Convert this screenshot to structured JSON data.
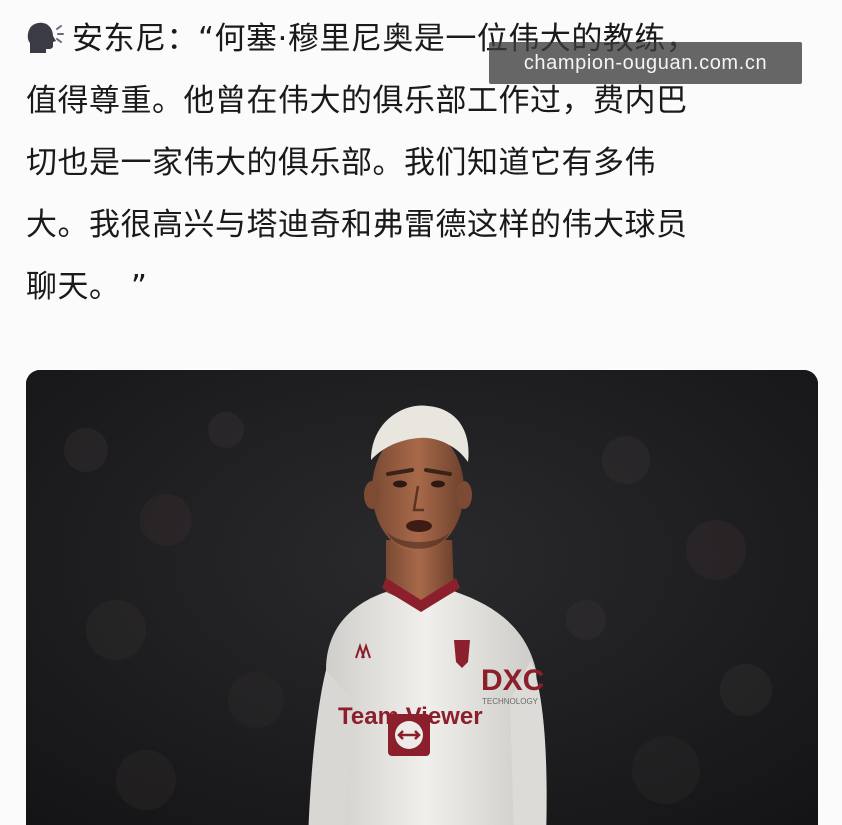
{
  "post": {
    "lines": [
      "安东尼：“何塞·穆里尼奥是一位伟大的教练，",
      "值得尊重。他曾在伟大的俱乐部工作过，费内巴",
      "切也是一家伟大的俱乐部。我们知道它有多伟",
      "大。我很高兴与塔迪奇和弗雷德这样的伟大球员",
      "聊天。 ”"
    ],
    "icon": "speaking-head-icon"
  },
  "watermark": {
    "text": "champion-ouguan.com.cn"
  },
  "photo": {
    "jersey_sponsor": "Team Viewer",
    "sleeve_sponsor": "DXC",
    "sleeve_sub": "TECHNOLOGY",
    "colors": {
      "background": "#1c1c1e",
      "kit": "#ecebe8",
      "trim": "#8b1f2c"
    }
  }
}
